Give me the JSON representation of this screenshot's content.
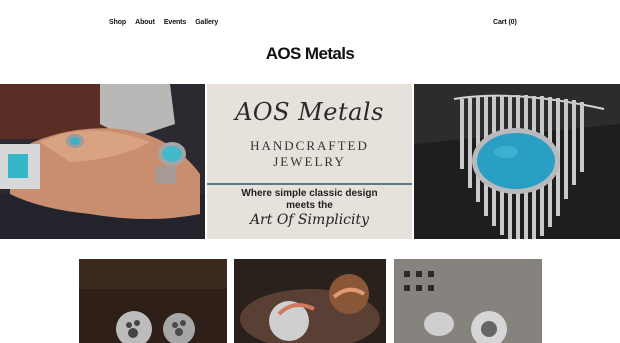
{
  "nav": {
    "items": [
      {
        "label": "Shop"
      },
      {
        "label": "About"
      },
      {
        "label": "Events"
      },
      {
        "label": "Gallery"
      }
    ],
    "cart_label": "Cart (0)"
  },
  "site": {
    "title": "AOS Metals"
  },
  "hero": {
    "brand_script": "AOS Metals",
    "brand_line1": "HANDCRAFTED",
    "brand_line2": "JEWELRY",
    "tagline_line1": "Where simple classic design",
    "tagline_line2": "meets the",
    "tagline_script": "Art Of Simplicity"
  },
  "colors": {
    "turquoise": "#2a9fc4",
    "silver": "#c9cacc",
    "panel_beige": "#e6e1da",
    "rule_blue": "#5b7c8c"
  }
}
